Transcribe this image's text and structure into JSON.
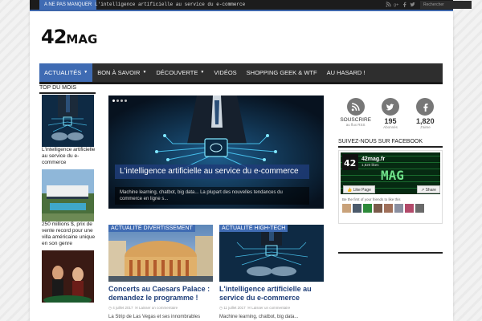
{
  "topbar": {
    "breaking_label": "A NE PAS MANQUER",
    "breaking_text": "L'intelligence artificielle au service du e-commerce",
    "search_placeholder": "Rechercher"
  },
  "logo": {
    "big": "42",
    "small": "MAG"
  },
  "nav": {
    "items": [
      {
        "label": "ACTUALITÉS",
        "dropdown": true,
        "active": true
      },
      {
        "label": "BON À SAVOIR",
        "dropdown": true
      },
      {
        "label": "DÉCOUVERTE",
        "dropdown": true
      },
      {
        "label": "VIDÉOS"
      },
      {
        "label": "SHOPPING GEEK & WTF"
      },
      {
        "label": "AU HASARD !"
      }
    ]
  },
  "top_month": {
    "title": "TOP DU MOIS",
    "items": [
      {
        "text": "L'intelligence artificielle au service du e-commerce"
      },
      {
        "text": "250 millions $, prix de vente record pour une villa américaine unique en son genre"
      },
      {
        "text": ""
      }
    ]
  },
  "slider": {
    "caption": "L'intelligence artificielle au service du e-commerce",
    "description": "Machine learning, chatbot, big data... La plupart des nouvelles tendances du commerce en ligne s...",
    "slides_count": 4,
    "active_index": 0
  },
  "cards": [
    {
      "category": "ACTUALITÉ DIVERTISSEMENT",
      "title": "Concerts au Caesars Palace : demandez le programme !",
      "date": "4 juillet 2017",
      "comments": "Laisser un commentaire",
      "excerpt": "La Strip de Las Vegas et ses innombrables"
    },
    {
      "category": "ACTUALITÉ HIGH-TECH",
      "title": "L'intelligence artificielle au service du e-commerce",
      "date": "11 juillet 2017",
      "comments": "Laisser un commentaire",
      "excerpt": "Machine learning, chatbot, big data..."
    }
  ],
  "social": [
    {
      "icon": "rss-icon",
      "count": "SOUSCRIRE",
      "sub": "au flux RSS"
    },
    {
      "icon": "twitter-icon",
      "count": "195",
      "sub": "Abonnés"
    },
    {
      "icon": "facebook-icon",
      "count": "1,820",
      "sub": "J'aime"
    }
  ],
  "facebook": {
    "title": "SUIVEZ-NOUS SUR FACEBOOK",
    "page_name": "42mag.fr",
    "likes": "1,820 likes",
    "like_button": "Like Page",
    "share_button": "Share",
    "friends_text": "Be the first of your friends to like this"
  },
  "colors": {
    "accent": "#3f6bb3",
    "nav_bg": "#2e2e2e",
    "title_blue": "#1f3f7a"
  }
}
